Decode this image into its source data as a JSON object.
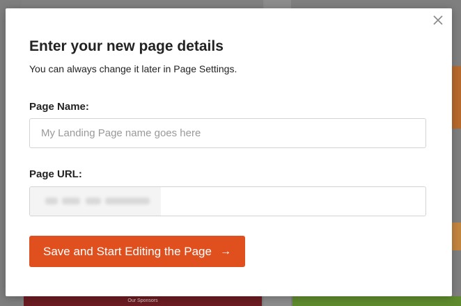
{
  "background": {
    "footer_text": "Our Sponsors"
  },
  "modal": {
    "title": "Enter your new page details",
    "subtitle": "You can always change it later in Page Settings.",
    "close_icon": "close-icon",
    "page_name": {
      "label": "Page Name:",
      "placeholder": "My Landing Page name goes here",
      "value": ""
    },
    "page_url": {
      "label": "Page URL:",
      "value": ""
    },
    "save_button": {
      "label": "Save and Start Editing the Page",
      "icon": "arrow-right-icon",
      "color": "#e0501f"
    }
  }
}
